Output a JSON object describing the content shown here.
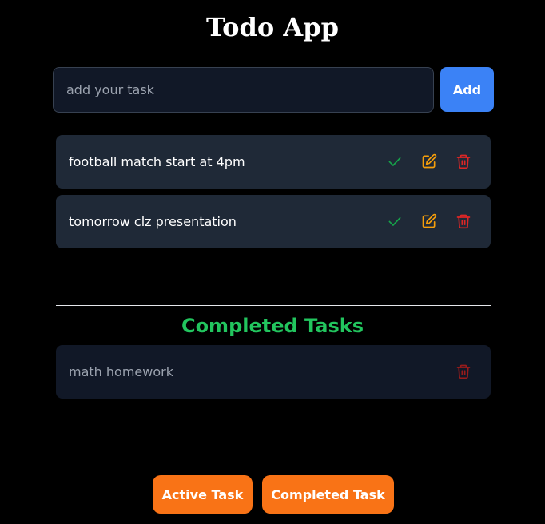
{
  "app": {
    "title": "Todo App"
  },
  "input": {
    "placeholder": "add your task",
    "value": ""
  },
  "add_button": {
    "label": "Add"
  },
  "active_tasks": [
    {
      "text": "football match start at 4pm",
      "icons": [
        "check-icon",
        "edit-icon",
        "trash-icon"
      ]
    },
    {
      "text": "tomorrow clz presentation",
      "icons": [
        "check-icon",
        "edit-icon",
        "trash-icon"
      ]
    }
  ],
  "completed_section": {
    "title": "Completed Tasks"
  },
  "completed_tasks": [
    {
      "text": "math homework",
      "icons": [
        "trash-icon"
      ]
    }
  ],
  "footer": {
    "active_label": "Active Task",
    "completed_label": "Completed Task"
  },
  "colors": {
    "background": "#000000",
    "input_bg": "#111827",
    "task_bg": "#1f2937",
    "completed_task_bg": "#111827",
    "add_button": "#3b82f6",
    "check": "#16a34a",
    "edit": "#f59e0b",
    "delete": "#dc2626",
    "completed_title": "#22c55e",
    "footer_button": "#f97316"
  }
}
